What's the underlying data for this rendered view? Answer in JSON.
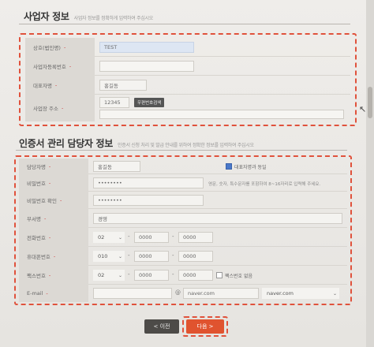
{
  "business_section": {
    "title": "사업자 정보",
    "note": "사업자 정보를 정확하게 입력하여 주십시오",
    "rows": [
      {
        "label": "상호(법인명)",
        "value": "TEST"
      },
      {
        "label": "사업자등록번호",
        "value": ""
      },
      {
        "label": "대표자명",
        "value": "홍길동"
      },
      {
        "label": "사업장 주소",
        "zip": "12345",
        "zip_button": "우편번호검색",
        "address": ""
      }
    ]
  },
  "manager_section": {
    "title": "인증서 관리 담당자 정보",
    "note": "인증서 신청 처리 및 발급 안내를 위하여 정확한 정보를 입력하여 주십시오",
    "rows": {
      "name": {
        "label": "담당자명",
        "value": "홍길동",
        "same_as_rep_label": "대표자명과 동일",
        "same_as_rep_checked": true
      },
      "password": {
        "label": "비밀번호",
        "value": "••••••••",
        "hint": "영문, 숫자, 특수문자를 포함하여 8~16자리로 입력해 주세요."
      },
      "password_confirm": {
        "label": "비밀번호 확인",
        "value": "••••••••"
      },
      "department": {
        "label": "부서명",
        "value": "경영"
      },
      "phone": {
        "label": "전화번호",
        "area": "02",
        "mid": "0000",
        "last": "0000"
      },
      "mobile": {
        "label": "휴대폰번호",
        "area": "010",
        "mid": "0000",
        "last": "0000"
      },
      "fax": {
        "label": "팩스번호",
        "area": "02",
        "mid": "0000",
        "last": "0000",
        "none_label": "팩스번호 없음",
        "none_checked": false
      },
      "email": {
        "label": "E-mail",
        "local": "",
        "at": "@",
        "domain": "naver.com",
        "domain_select": "naver.com"
      }
    }
  },
  "buttons": {
    "prev": "< 이전",
    "next": "다음 >"
  },
  "colors": {
    "highlight": "#e0523c",
    "next_button": "#e0532f",
    "label_bg": "#dcd9d4"
  }
}
